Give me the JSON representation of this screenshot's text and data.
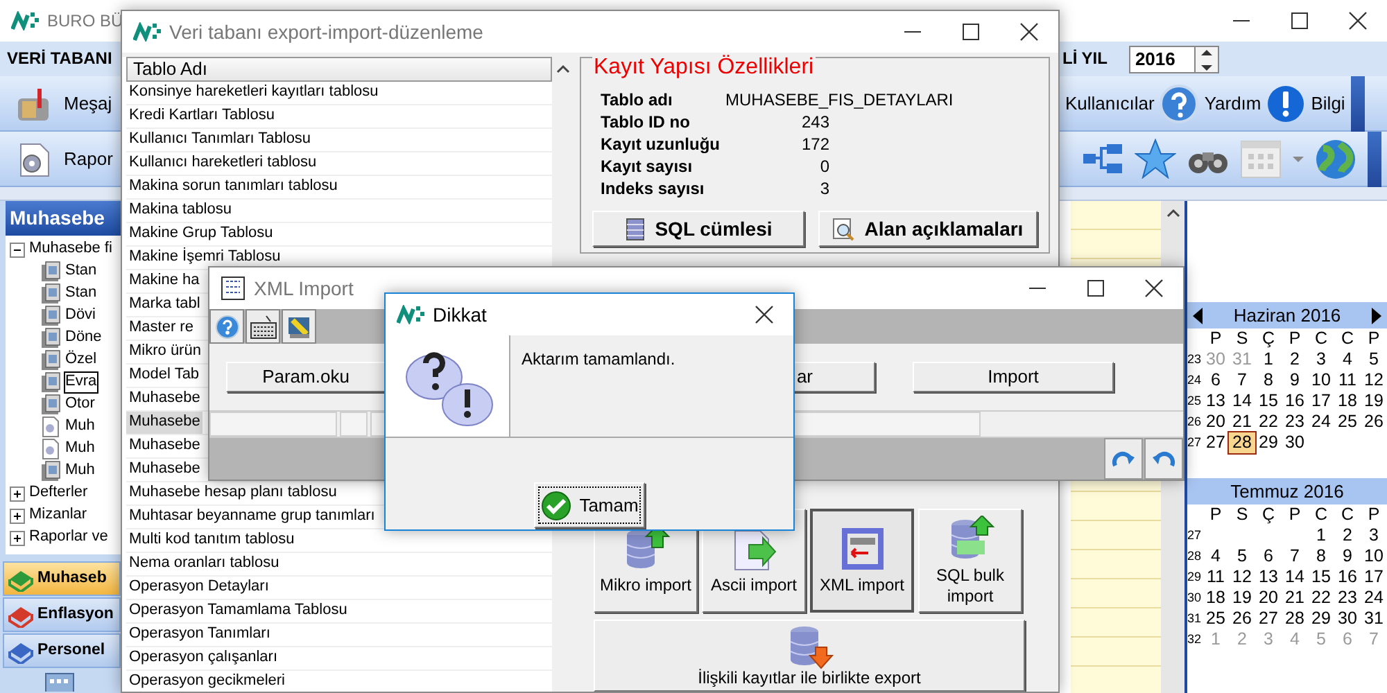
{
  "main_window": {
    "title": "BURO BÜ",
    "menu": "VERİ TABANI",
    "year_label": "Lİ YIL",
    "year": "2016",
    "toolbar_left": [
      {
        "label": "Meşaj",
        "kind": "mailbox"
      },
      {
        "label": "Rapor",
        "kind": "report"
      }
    ],
    "toolbar_right": [
      {
        "label": "Kullanıcılar",
        "kind": "none"
      },
      {
        "label": "Yardım",
        "kind": "help"
      },
      {
        "label": "Bilgi",
        "kind": "info"
      }
    ],
    "sidebar": {
      "title": "Muhasebe",
      "tree": [
        {
          "label": "Muhasebe fi",
          "expanded": true,
          "children": [
            {
              "label": "Stan",
              "kind": "table",
              "selected": false
            },
            {
              "label": "Stan",
              "kind": "table",
              "selected": false
            },
            {
              "label": "Dövi",
              "kind": "table",
              "selected": false
            },
            {
              "label": "Döne",
              "kind": "table",
              "selected": false
            },
            {
              "label": "Özel",
              "kind": "table",
              "selected": false
            },
            {
              "label": "Evra",
              "kind": "table",
              "selected": true
            },
            {
              "label": "Otor",
              "kind": "table",
              "selected": false
            },
            {
              "label": "Muh",
              "kind": "report",
              "selected": false
            },
            {
              "label": "Muh",
              "kind": "report",
              "selected": false
            },
            {
              "label": "Muh",
              "kind": "table",
              "selected": false
            }
          ]
        },
        {
          "label": "Defterler",
          "expanded": false
        },
        {
          "label": "Mizanlar",
          "expanded": false
        },
        {
          "label": "Raporlar ve",
          "expanded": false
        }
      ],
      "nav": [
        {
          "label": "Muhaseb",
          "selected": true,
          "color": "#2e9a3a"
        },
        {
          "label": "Enflasyon",
          "selected": false,
          "color": "#d43a2a"
        },
        {
          "label": "Personel",
          "selected": false,
          "color": "#3a66c4"
        }
      ]
    },
    "calendars": [
      {
        "title": "Haziran 2016",
        "weekdays": [
          "P",
          "S",
          "Ç",
          "P",
          "C",
          "C",
          "P"
        ],
        "weeks": [
          {
            "number": "23",
            "days": [
              {
                "d": "30",
                "muted": true,
                "selected": false
              },
              {
                "d": "31",
                "muted": true,
                "selected": false
              },
              {
                "d": "1",
                "muted": false,
                "selected": false
              },
              {
                "d": "2",
                "muted": false,
                "selected": false
              },
              {
                "d": "3",
                "muted": false,
                "selected": false
              },
              {
                "d": "4",
                "muted": false,
                "selected": false
              },
              {
                "d": "5",
                "muted": false,
                "selected": false
              }
            ]
          },
          {
            "number": "24",
            "days": [
              {
                "d": "6",
                "muted": false,
                "selected": false
              },
              {
                "d": "7",
                "muted": false,
                "selected": false
              },
              {
                "d": "8",
                "muted": false,
                "selected": false
              },
              {
                "d": "9",
                "muted": false,
                "selected": false
              },
              {
                "d": "10",
                "muted": false,
                "selected": false
              },
              {
                "d": "11",
                "muted": false,
                "selected": false
              },
              {
                "d": "12",
                "muted": false,
                "selected": false
              }
            ]
          },
          {
            "number": "25",
            "days": [
              {
                "d": "13",
                "muted": false,
                "selected": false
              },
              {
                "d": "14",
                "muted": false,
                "selected": false
              },
              {
                "d": "15",
                "muted": false,
                "selected": false
              },
              {
                "d": "16",
                "muted": false,
                "selected": false
              },
              {
                "d": "17",
                "muted": false,
                "selected": false
              },
              {
                "d": "18",
                "muted": false,
                "selected": false
              },
              {
                "d": "19",
                "muted": false,
                "selected": false
              }
            ]
          },
          {
            "number": "26",
            "days": [
              {
                "d": "20",
                "muted": false,
                "selected": false
              },
              {
                "d": "21",
                "muted": false,
                "selected": false
              },
              {
                "d": "22",
                "muted": false,
                "selected": false
              },
              {
                "d": "23",
                "muted": false,
                "selected": false
              },
              {
                "d": "24",
                "muted": false,
                "selected": false
              },
              {
                "d": "25",
                "muted": false,
                "selected": false
              },
              {
                "d": "26",
                "muted": false,
                "selected": false
              }
            ]
          },
          {
            "number": "27",
            "days": [
              {
                "d": "27",
                "muted": false,
                "selected": false
              },
              {
                "d": "28",
                "muted": false,
                "selected": true
              },
              {
                "d": "29",
                "muted": false,
                "selected": false
              },
              {
                "d": "30",
                "muted": false,
                "selected": false
              }
            ]
          }
        ]
      },
      {
        "title": "Temmuz 2016",
        "weekdays": [
          "P",
          "S",
          "Ç",
          "P",
          "C",
          "C",
          "P"
        ],
        "weeks": [
          {
            "number": "27",
            "days": [
              {
                "d": "1",
                "muted": false,
                "selected": false
              },
              {
                "d": "2",
                "muted": false,
                "selected": false
              },
              {
                "d": "3",
                "muted": false,
                "selected": false
              }
            ]
          },
          {
            "number": "28",
            "days": [
              {
                "d": "4",
                "muted": false,
                "selected": false
              },
              {
                "d": "5",
                "muted": false,
                "selected": false
              },
              {
                "d": "6",
                "muted": false,
                "selected": false
              },
              {
                "d": "7",
                "muted": false,
                "selected": false
              },
              {
                "d": "8",
                "muted": false,
                "selected": false
              },
              {
                "d": "9",
                "muted": false,
                "selected": false
              },
              {
                "d": "10",
                "muted": false,
                "selected": false
              }
            ]
          },
          {
            "number": "29",
            "days": [
              {
                "d": "11",
                "muted": false,
                "selected": false
              },
              {
                "d": "12",
                "muted": false,
                "selected": false
              },
              {
                "d": "13",
                "muted": false,
                "selected": false
              },
              {
                "d": "14",
                "muted": false,
                "selected": false
              },
              {
                "d": "15",
                "muted": false,
                "selected": false
              },
              {
                "d": "16",
                "muted": false,
                "selected": false
              },
              {
                "d": "17",
                "muted": false,
                "selected": false
              }
            ]
          },
          {
            "number": "30",
            "days": [
              {
                "d": "18",
                "muted": false,
                "selected": false
              },
              {
                "d": "19",
                "muted": false,
                "selected": false
              },
              {
                "d": "20",
                "muted": false,
                "selected": false
              },
              {
                "d": "21",
                "muted": false,
                "selected": false
              },
              {
                "d": "22",
                "muted": false,
                "selected": false
              },
              {
                "d": "23",
                "muted": false,
                "selected": false
              },
              {
                "d": "24",
                "muted": false,
                "selected": false
              }
            ]
          },
          {
            "number": "31",
            "days": [
              {
                "d": "25",
                "muted": false,
                "selected": false
              },
              {
                "d": "26",
                "muted": false,
                "selected": false
              },
              {
                "d": "27",
                "muted": false,
                "selected": false
              },
              {
                "d": "28",
                "muted": false,
                "selected": false
              },
              {
                "d": "29",
                "muted": false,
                "selected": false
              },
              {
                "d": "30",
                "muted": false,
                "selected": false
              },
              {
                "d": "31",
                "muted": false,
                "selected": false
              }
            ]
          },
          {
            "number": "32",
            "days": [
              {
                "d": "1",
                "muted": true,
                "selected": false
              },
              {
                "d": "2",
                "muted": true,
                "selected": false
              },
              {
                "d": "3",
                "muted": true,
                "selected": false
              },
              {
                "d": "4",
                "muted": true,
                "selected": false
              },
              {
                "d": "5",
                "muted": true,
                "selected": false
              },
              {
                "d": "6",
                "muted": true,
                "selected": false
              },
              {
                "d": "7",
                "muted": true,
                "selected": false
              }
            ]
          }
        ]
      }
    ]
  },
  "export_window": {
    "title": "Veri tabanı export-import-düzenleme",
    "list": {
      "header": "Tablo Adı",
      "rows": [
        {
          "label": "Konsinye hareketleri kayıtları tablosu",
          "selected": false
        },
        {
          "label": "Kredi Kartları Tablosu",
          "selected": false
        },
        {
          "label": "Kullanıcı Tanımları Tablosu",
          "selected": false
        },
        {
          "label": "Kullanıcı hareketleri tablosu",
          "selected": false
        },
        {
          "label": "Makina sorun tanımları tablosu",
          "selected": false
        },
        {
          "label": "Makina tablosu",
          "selected": false
        },
        {
          "label": "Makine Grup Tablosu",
          "selected": false
        },
        {
          "label": "Makine İşemri Tablosu",
          "selected": false
        },
        {
          "label": "Makine ha",
          "selected": false
        },
        {
          "label": "Marka tabl",
          "selected": false
        },
        {
          "label": "Master re",
          "selected": false
        },
        {
          "label": "Mikro ürün",
          "selected": false
        },
        {
          "label": "Model Tab",
          "selected": false
        },
        {
          "label": "Muhasebe",
          "selected": false
        },
        {
          "label": "Muhasebe",
          "selected": true
        },
        {
          "label": "Muhasebe",
          "selected": false
        },
        {
          "label": "Muhasebe",
          "selected": false
        },
        {
          "label": "Muhasebe hesap planı tablosu",
          "selected": false
        },
        {
          "label": "Muhtasar beyanname grup tanımları",
          "selected": false
        },
        {
          "label": "Multi kod tanıtım tablosu",
          "selected": false
        },
        {
          "label": "Nema oranları tablosu",
          "selected": false
        },
        {
          "label": "Operasyon Detayları",
          "selected": false
        },
        {
          "label": "Operasyon Tamamlama Tablosu",
          "selected": false
        },
        {
          "label": "Operasyon Tanımları",
          "selected": false
        },
        {
          "label": "Operasyon çalışanları",
          "selected": false
        },
        {
          "label": "Operasyon gecikmeleri",
          "selected": false
        }
      ]
    },
    "properties": {
      "title": "Kayıt Yapısı Özellikleri",
      "fields": [
        {
          "label": "Tablo adı",
          "value": "MUHASEBE_FIS_DETAYLARI",
          "kind": "text"
        },
        {
          "label": "Tablo ID no",
          "value": "243",
          "kind": "number"
        },
        {
          "label": "Kayıt uzunluğu",
          "value": "172",
          "kind": "number"
        },
        {
          "label": "Kayıt sayısı",
          "value": "0",
          "kind": "number"
        },
        {
          "label": "Indeks sayısı",
          "value": "3",
          "kind": "number"
        }
      ],
      "buttons": [
        {
          "label": "SQL cümlesi",
          "kind": "sql"
        },
        {
          "label": "Alan açıklamaları",
          "kind": "search"
        }
      ]
    },
    "import_buttons": [
      {
        "label": "Mikro import",
        "kind": "db",
        "selected": false
      },
      {
        "label": "Ascii import",
        "kind": "file",
        "selected": false
      },
      {
        "label": "XML import",
        "kind": "xml",
        "selected": true
      },
      {
        "label": "SQL bulk import",
        "kind": "sql",
        "selected": false
      }
    ],
    "export_button": "İlişkili kayıtlar ile birlikte export"
  },
  "xml_window": {
    "title": "XML Import",
    "buttons": [
      "Param.oku",
      "ar",
      "Import"
    ]
  },
  "dialog": {
    "title": "Dikkat",
    "message": "Aktarım tamamlandı.",
    "button": "Tamam"
  }
}
